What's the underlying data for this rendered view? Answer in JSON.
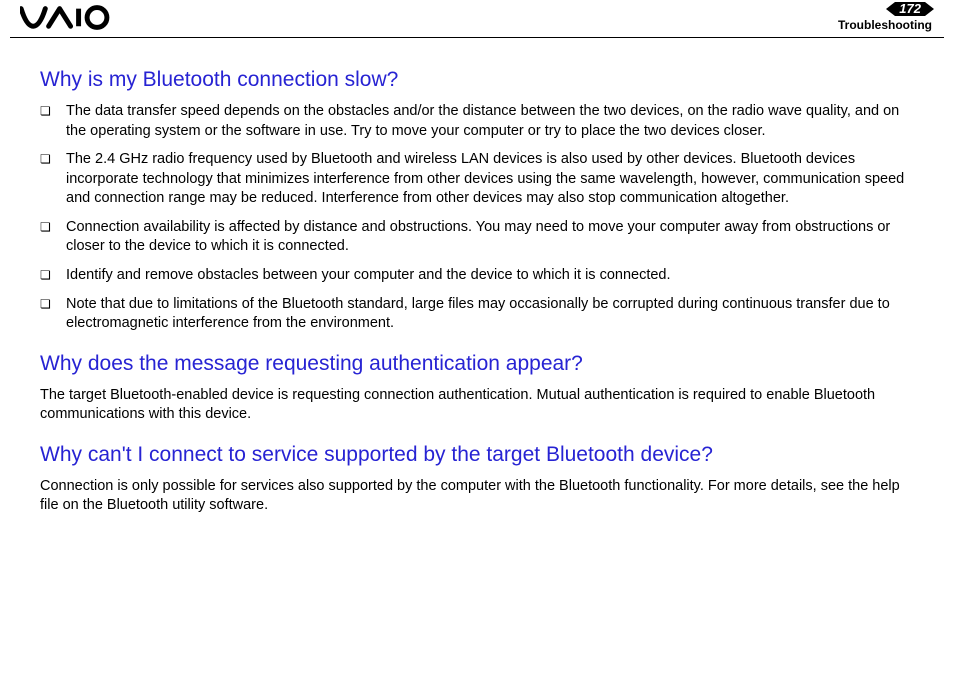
{
  "header": {
    "page_number": "172",
    "section": "Troubleshooting"
  },
  "q1": {
    "title": "Why is my Bluetooth connection slow?",
    "items": [
      "The data transfer speed depends on the obstacles and/or the distance between the two devices, on the radio wave quality, and on the operating system or the software in use. Try to move your computer or try to place the two devices closer.",
      "The 2.4 GHz radio frequency used by Bluetooth and wireless LAN devices is also used by other devices. Bluetooth devices incorporate technology that minimizes interference from other devices using the same wavelength, however, communication speed and connection range may be reduced. Interference from other devices may also stop communication altogether.",
      "Connection availability is affected by distance and obstructions. You may need to move your computer away from obstructions or closer to the device to which it is connected.",
      "Identify and remove obstacles between your computer and the device to which it is connected.",
      "Note that due to limitations of the Bluetooth standard, large files may occasionally be corrupted during continuous transfer due to electromagnetic interference from the environment."
    ]
  },
  "q2": {
    "title": "Why does the message requesting authentication appear?",
    "body": "The target Bluetooth-enabled device is requesting connection authentication. Mutual authentication is required to enable Bluetooth communications with this device."
  },
  "q3": {
    "title": "Why can't I connect to service supported by the target Bluetooth device?",
    "body": "Connection is only possible for services also supported by the computer with the Bluetooth functionality. For more details, see the help file on the Bluetooth utility software."
  }
}
